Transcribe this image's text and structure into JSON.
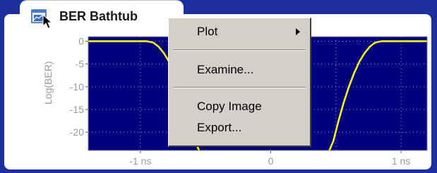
{
  "window": {
    "title": "BER Bathtub",
    "icon": "chart-window-icon"
  },
  "chart_data": {
    "type": "line",
    "title": "",
    "xlabel": "",
    "ylabel": "Log(BER)",
    "x_ticks": [
      "-1 ns",
      "0",
      "1 ns"
    ],
    "y_ticks": [
      "0",
      "-5",
      "-10",
      "-15",
      "-20"
    ],
    "xlim": [
      -1.4,
      1.2
    ],
    "ylim": [
      -24,
      1
    ],
    "grid": true,
    "colors": {
      "background": "#00007f",
      "line": "#ffff00",
      "grid": "#a0a0c8"
    },
    "series": [
      {
        "values_left": [
          [
            -1.4,
            0
          ],
          [
            -0.95,
            0
          ],
          [
            -0.9,
            -0.3
          ],
          [
            -0.86,
            -1.2
          ],
          [
            -0.82,
            -2.6
          ],
          [
            -0.78,
            -4.5
          ],
          [
            -0.74,
            -7
          ],
          [
            -0.7,
            -10
          ],
          [
            -0.66,
            -13.5
          ],
          [
            -0.62,
            -17.5
          ],
          [
            -0.58,
            -22
          ],
          [
            -0.55,
            -25
          ]
        ],
        "values_right": [
          [
            0.45,
            -25
          ],
          [
            0.48,
            -22
          ],
          [
            0.52,
            -17.5
          ],
          [
            0.56,
            -13.5
          ],
          [
            0.6,
            -10
          ],
          [
            0.64,
            -7
          ],
          [
            0.68,
            -4.5
          ],
          [
            0.72,
            -2.6
          ],
          [
            0.76,
            -1.2
          ],
          [
            0.8,
            -0.3
          ],
          [
            0.85,
            0
          ],
          [
            1.2,
            0
          ]
        ]
      }
    ]
  },
  "context_menu": {
    "items": [
      {
        "label": "Plot",
        "submenu": true
      },
      {
        "separator": true
      },
      {
        "label": "Examine..."
      },
      {
        "separator": true
      },
      {
        "label": "Copy Image"
      },
      {
        "label": "Export..."
      }
    ]
  }
}
